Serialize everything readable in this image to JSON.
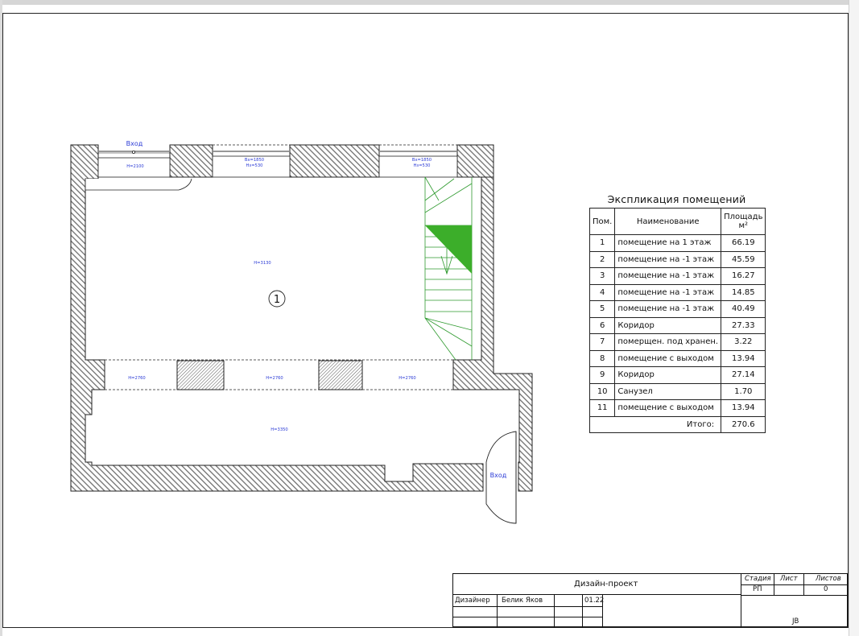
{
  "plan": {
    "entrance_top": "Вход",
    "entrance_bottom": "Вход",
    "room_number": "1",
    "labels": {
      "door_top_height": "H=2100",
      "window1_line1": "Вх=1850",
      "window1_line2": "Нз=530",
      "window2_line1": "Вх=1850",
      "window2_line2": "Нз=530",
      "room_height": "H=3130",
      "opening1": "H=2760",
      "opening2": "H=2760",
      "opening3": "H=2760",
      "corridor_height": "H=3350"
    },
    "colors": {
      "wall_hatch": "#7a7a7a",
      "label_blue": "#2b3bd6",
      "stair_green": "#2e9a2e",
      "arrow_fill": "#3cae2a"
    }
  },
  "explication": {
    "title": "Экспликация помещений",
    "headers": {
      "num": "Пом.",
      "name": "Наименование",
      "area": "Площадь м²"
    },
    "rows": [
      {
        "num": "1",
        "name": "помещение на 1 этаж",
        "area": "66.19"
      },
      {
        "num": "2",
        "name": "помещение на -1 этаж",
        "area": "45.59"
      },
      {
        "num": "3",
        "name": "помещение на -1 этаж",
        "area": "16.27"
      },
      {
        "num": "4",
        "name": "помещение на -1 этаж",
        "area": "14.85"
      },
      {
        "num": "5",
        "name": "помещение на -1 этаж",
        "area": "40.49"
      },
      {
        "num": "6",
        "name": "Коридор",
        "area": "27.33"
      },
      {
        "num": "7",
        "name": "померщен. под хранен.",
        "area": "3.22"
      },
      {
        "num": "8",
        "name": "помещение с выходом",
        "area": "13.94"
      },
      {
        "num": "9",
        "name": "Коридор",
        "area": "27.14"
      },
      {
        "num": "10",
        "name": "Санузел",
        "area": "1.70"
      },
      {
        "num": "11",
        "name": "помещение с выходом",
        "area": "13.94"
      }
    ],
    "total_label": "Итого:",
    "total_value": "270.6"
  },
  "stamp": {
    "project_title": "Дизайн-проект",
    "stage_label": "Стадия",
    "sheet_label": "Лист",
    "sheets_label": "Листов",
    "stage_value": "РП",
    "sheets_value": "0",
    "role": "Дизайнер",
    "person": "Белик Яков",
    "date": "01.22",
    "mark": "JB"
  }
}
